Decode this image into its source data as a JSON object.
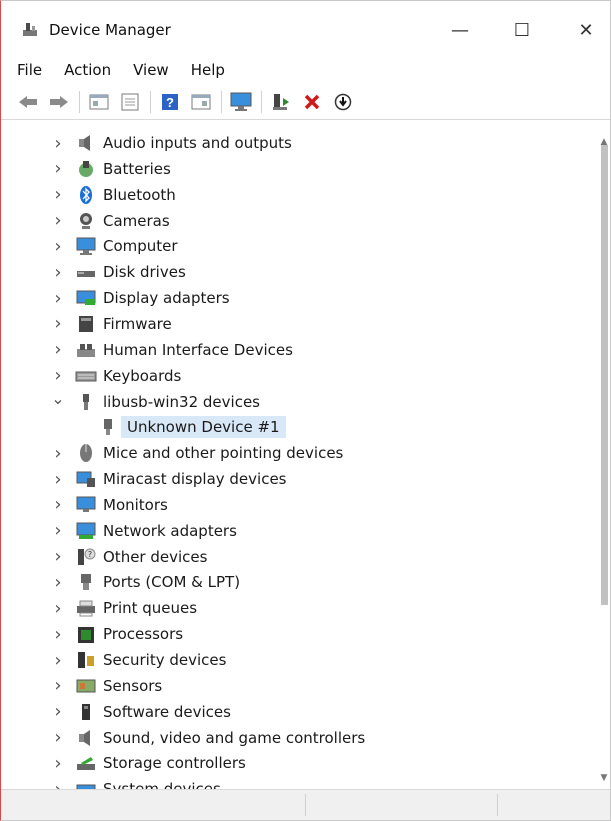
{
  "window": {
    "title": "Device Manager",
    "minimize": "—",
    "maximize": "☐",
    "close": "✕"
  },
  "menu": [
    "File",
    "Action",
    "View",
    "Help"
  ],
  "toolbar": [
    {
      "name": "back-icon"
    },
    {
      "name": "forward-icon"
    },
    {
      "name": "properties-icon"
    },
    {
      "name": "show-hidden-icon"
    },
    {
      "name": "help-icon"
    },
    {
      "name": "details-icon"
    },
    {
      "name": "monitor-icon"
    },
    {
      "name": "update-driver-icon"
    },
    {
      "name": "uninstall-icon"
    },
    {
      "name": "scan-hardware-icon"
    }
  ],
  "tree": [
    {
      "label": "Audio inputs and outputs",
      "icon": "speaker-icon",
      "expanded": false
    },
    {
      "label": "Batteries",
      "icon": "battery-icon",
      "expanded": false
    },
    {
      "label": "Bluetooth",
      "icon": "bluetooth-icon",
      "expanded": false
    },
    {
      "label": "Cameras",
      "icon": "camera-icon",
      "expanded": false
    },
    {
      "label": "Computer",
      "icon": "computer-icon",
      "expanded": false
    },
    {
      "label": "Disk drives",
      "icon": "disk-drive-icon",
      "expanded": false
    },
    {
      "label": "Display adapters",
      "icon": "display-adapter-icon",
      "expanded": false
    },
    {
      "label": "Firmware",
      "icon": "firmware-icon",
      "expanded": false
    },
    {
      "label": "Human Interface Devices",
      "icon": "hid-icon",
      "expanded": false
    },
    {
      "label": "Keyboards",
      "icon": "keyboard-icon",
      "expanded": false
    },
    {
      "label": "libusb-win32 devices",
      "icon": "usb-icon",
      "expanded": true
    },
    {
      "label": "Unknown Device #1",
      "icon": "usb-device-icon",
      "child": true,
      "selected": true
    },
    {
      "label": "Mice and other pointing devices",
      "icon": "mouse-icon",
      "expanded": false
    },
    {
      "label": "Miracast display devices",
      "icon": "miracast-icon",
      "expanded": false
    },
    {
      "label": "Monitors",
      "icon": "monitor-icon",
      "expanded": false
    },
    {
      "label": "Network adapters",
      "icon": "network-adapter-icon",
      "expanded": false
    },
    {
      "label": "Other devices",
      "icon": "other-devices-icon",
      "expanded": false
    },
    {
      "label": "Ports (COM & LPT)",
      "icon": "port-icon",
      "expanded": false
    },
    {
      "label": "Print queues",
      "icon": "printer-icon",
      "expanded": false
    },
    {
      "label": "Processors",
      "icon": "processor-icon",
      "expanded": false
    },
    {
      "label": "Security devices",
      "icon": "security-icon",
      "expanded": false
    },
    {
      "label": "Sensors",
      "icon": "sensor-icon",
      "expanded": false
    },
    {
      "label": "Software devices",
      "icon": "software-device-icon",
      "expanded": false
    },
    {
      "label": "Sound, video and game controllers",
      "icon": "sound-icon",
      "expanded": false
    },
    {
      "label": "Storage controllers",
      "icon": "storage-icon",
      "expanded": false
    },
    {
      "label": "System devices",
      "icon": "system-icon",
      "expanded": false
    }
  ],
  "colors": {
    "selection": "#d9e8f7",
    "close_red": "#d01818",
    "green": "#2e8b2e",
    "blue": "#2b7fd8"
  }
}
